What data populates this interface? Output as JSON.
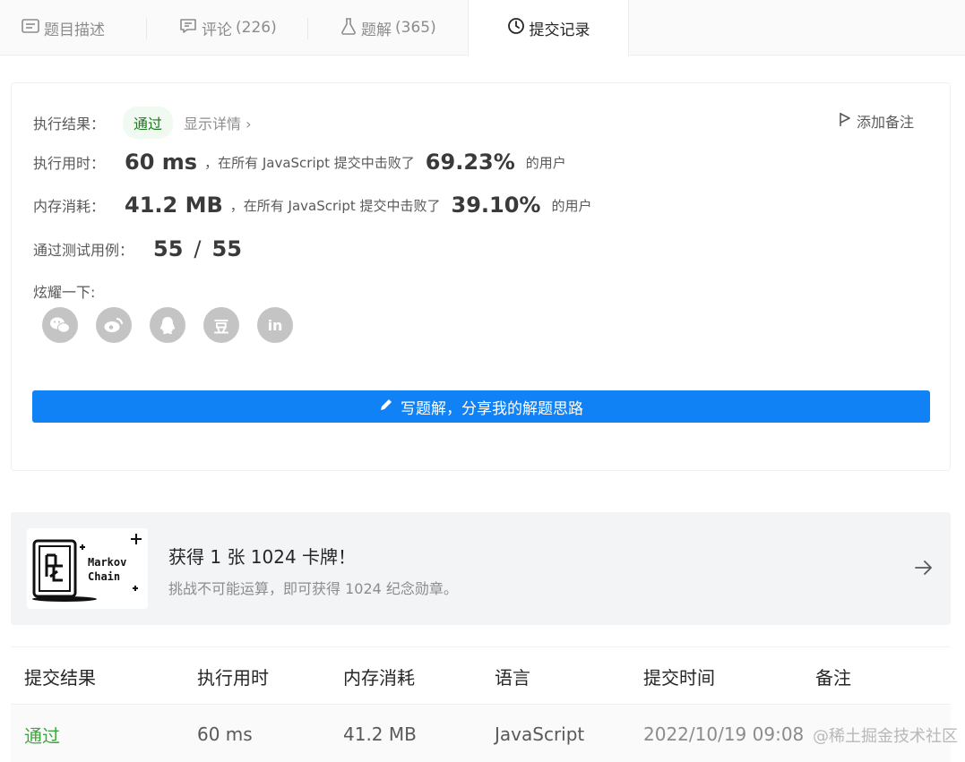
{
  "tabs": [
    {
      "label": "题目描述",
      "count": "",
      "icon": "description-icon"
    },
    {
      "label": "评论",
      "count": "(226)",
      "icon": "comment-icon"
    },
    {
      "label": "题解",
      "count": "(365)",
      "icon": "flask-icon"
    },
    {
      "label": "提交记录",
      "count": "",
      "icon": "clock-icon"
    }
  ],
  "result": {
    "status_label": "执行结果：",
    "status": "通过",
    "detail_link": "显示详情 ›",
    "add_note": "添加备注",
    "runtime_label": "执行用时：",
    "runtime": "60 ms",
    "runtime_text": "，在所有 JavaScript 提交中击败了",
    "runtime_pct": "69.23%",
    "runtime_suffix": "的用户",
    "memory_label": "内存消耗：",
    "memory": "41.2 MB",
    "memory_text": "，在所有 JavaScript 提交中击败了",
    "memory_pct": "39.10%",
    "memory_suffix": "的用户",
    "tests_label": "通过测试用例：",
    "tests_passed": "55",
    "tests_sep": "/",
    "tests_total": "55",
    "share_label": "炫耀一下:",
    "share_icons": [
      "wechat-icon",
      "weibo-icon",
      "qq-icon",
      "douban-icon",
      "linkedin-icon"
    ],
    "douban_glyph": "豆",
    "linkedin_glyph": "in",
    "write_button": "写题解，分享我的解题思路"
  },
  "promo": {
    "title": "获得 1 张 1024 卡牌！",
    "subtitle": "挑战不可能运算，即可获得 1024 纪念勋章。",
    "card_text_1": "Markov",
    "card_text_2": "Chain"
  },
  "table": {
    "headers": [
      "提交结果",
      "执行用时",
      "内存消耗",
      "语言",
      "提交时间",
      "备注"
    ],
    "rows": [
      {
        "result": "通过",
        "runtime": "60 ms",
        "memory": "41.2 MB",
        "language": "JavaScript",
        "time": "2022/10/19 09:08"
      }
    ],
    "watermark": "@稀土掘金技术社区"
  },
  "colors": {
    "primary": "#1182f6",
    "success": "#3ba63b",
    "badge_bg": "#f0faf0",
    "promo_bg": "#f3f4f5"
  }
}
